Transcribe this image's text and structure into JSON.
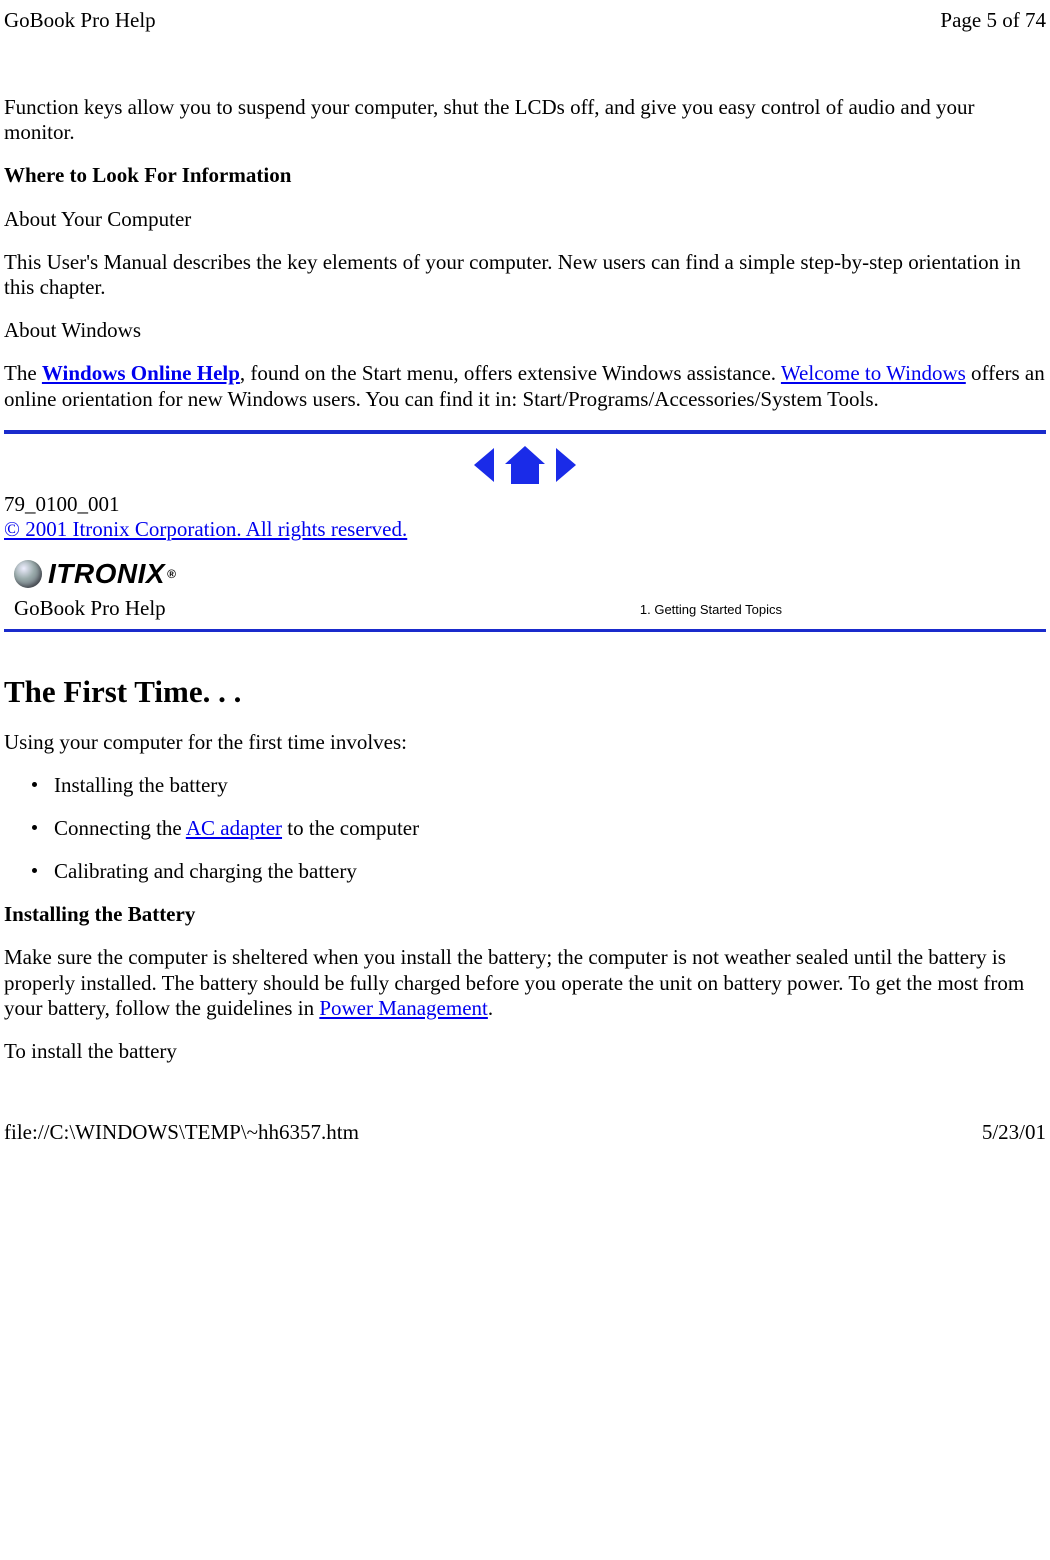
{
  "header": {
    "title": "GoBook Pro Help",
    "page_info": "Page 5 of 74"
  },
  "intro_para": "Function keys allow you to suspend your computer, shut the LCDs off, and give you easy control of audio and your monitor.",
  "where_heading": "Where to Look For Information",
  "about_computer_heading": "About Your Computer",
  "about_computer_para": "This User's Manual describes the key elements of your computer. New users can find a simple step-by-step orientation in this chapter.",
  "about_windows_heading": "About Windows",
  "about_windows_para": {
    "prefix": "The ",
    "link1": "Windows Online Help",
    "after_link1": ", found on the Start menu, offers extensive Windows assistance.  ",
    "link2": "Welcome to Windows",
    "after_link2": " offers an online orientation for new Windows users.  You can find it in:  Start/Programs/Accessories/System Tools."
  },
  "doc_id": "79_0100_001",
  "copyright": "© 2001 Itronix Corporation.  All rights reserved.",
  "logo_text": "ITRONIX",
  "gobook_help_label": "GoBook Pro Help",
  "topics_label": "1. Getting Started Topics",
  "h2_first_time": "The First Time. . .",
  "first_time_intro": "Using your computer for the first time involves:",
  "bullets": {
    "b1": "Installing  the battery",
    "b2_prefix": "Connecting the ",
    "b2_link": "AC adapter",
    "b2_suffix": " to the computer",
    "b3": "Calibrating and charging the battery"
  },
  "installing_heading": "Installing the Battery",
  "installing_para": {
    "text1": "Make sure the computer is sheltered when you install the battery; the computer is not weather sealed until the battery is properly installed. The battery should be fully charged before you operate the unit on battery power. To get the most from your battery, follow the guidelines in ",
    "link": "Power Management",
    "text2": "."
  },
  "to_install": "To install the battery",
  "footer": {
    "path": "file://C:\\WINDOWS\\TEMP\\~hh6357.htm",
    "date": "5/23/01"
  }
}
